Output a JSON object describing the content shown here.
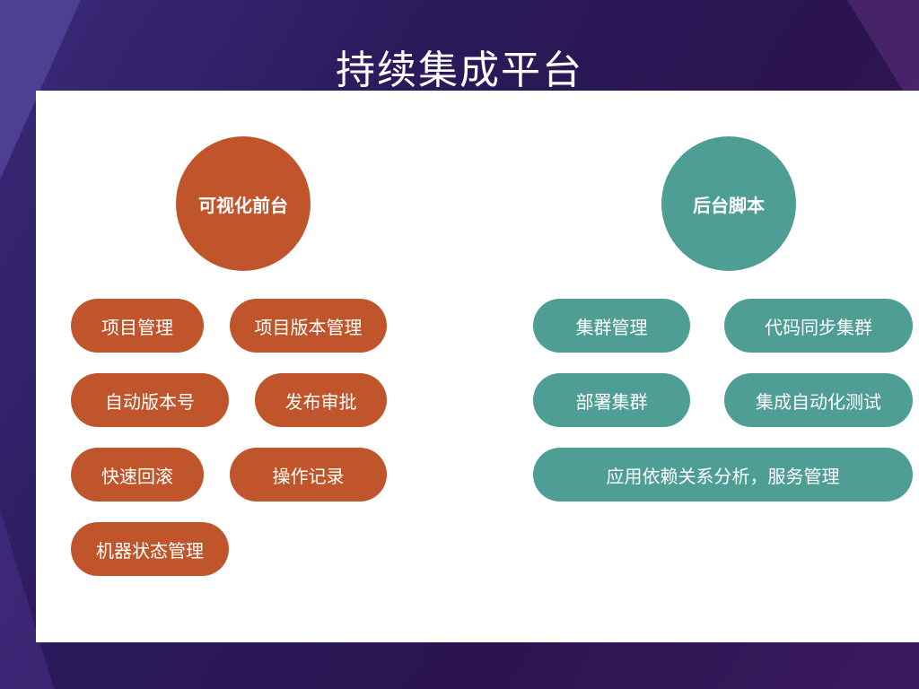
{
  "title": "持续集成平台",
  "colors": {
    "frontend": "#c0552b",
    "backend": "#4e9e95",
    "panel": "#ffffff"
  },
  "frontend": {
    "heading": "可视化前台",
    "items": [
      "项目管理",
      "项目版本管理",
      "自动版本号",
      "发布审批",
      "快速回滚",
      "操作记录",
      "机器状态管理"
    ]
  },
  "backend": {
    "heading": "后台脚本",
    "items": [
      "集群管理",
      "代码同步集群",
      "部署集群",
      "集成自动化测试",
      "应用依赖关系分析，服务管理"
    ]
  }
}
